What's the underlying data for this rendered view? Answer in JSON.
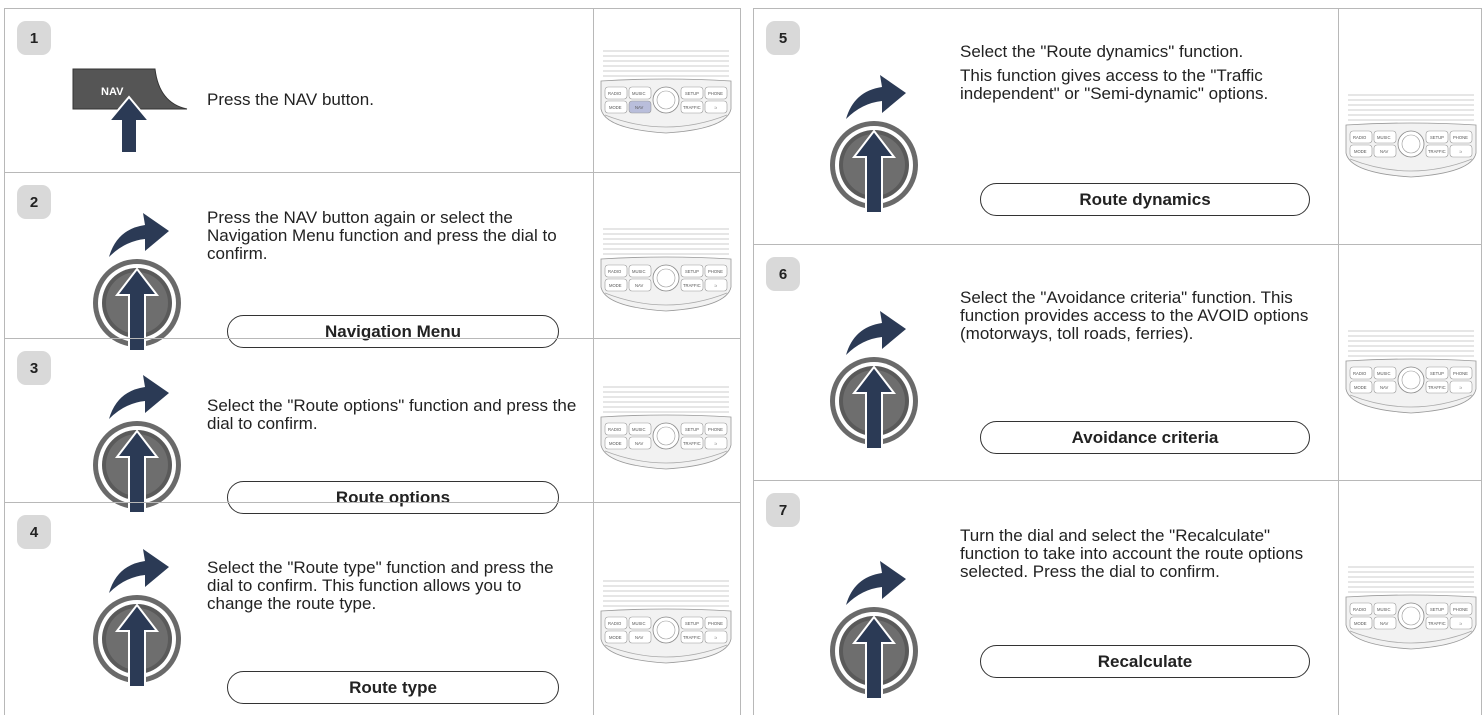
{
  "left_steps": [
    {
      "num": "1",
      "text": [
        "Press the NAV button."
      ],
      "pill": "",
      "nav_label": "NAV"
    },
    {
      "num": "2",
      "text": [
        "Press the NAV button again or select the Navigation Menu function and press the dial to confirm."
      ],
      "pill": "Navigation Menu"
    },
    {
      "num": "3",
      "text": [
        "Select the \"Route options\" function and press the dial to confirm."
      ],
      "pill": "Route options"
    },
    {
      "num": "4",
      "text": [
        "Select the \"Route type\" function and press the dial to confirm. This function allows you to change the route type."
      ],
      "pill": "Route type"
    }
  ],
  "right_steps": [
    {
      "num": "5",
      "text": [
        "Select the \"Route dynamics\" function.",
        "This function gives access to the \"Traffic independent\" or \"Semi-dynamic\" options."
      ],
      "pill": "Route dynamics"
    },
    {
      "num": "6",
      "text": [
        "Select the \"Avoidance criteria\" function. This function provides access to the AVOID options (motorways, toll roads, ferries)."
      ],
      "pill": "Avoidance criteria"
    },
    {
      "num": "7",
      "text": [
        "Turn the dial and select the \"Recalculate\" function to take into account the route options selected. Press the dial to confirm."
      ],
      "pill": "Recalculate"
    }
  ],
  "panel_labels": {
    "radio": "RADIO",
    "music": "MUSIC",
    "setup": "SETUP",
    "phone": "PHONE",
    "mode": "MODE",
    "nav": "NAV",
    "traffic": "TRAFFIC",
    "back": "⊃"
  },
  "colors": {
    "arrow": "#2b3a55",
    "dial": "#555555",
    "nav_highlight": "#b9bedb"
  }
}
